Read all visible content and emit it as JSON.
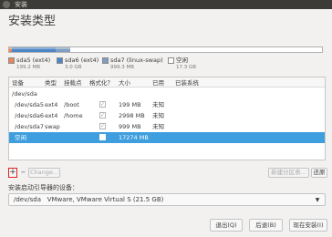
{
  "window": {
    "title": "安装"
  },
  "page": {
    "heading": "安装类型"
  },
  "partition_bar": {
    "segments": [
      {
        "name": "sda5 (ext4)",
        "color": "#e5875a",
        "fraction": 0.0093
      },
      {
        "name": "sda6 (ext4)",
        "color": "#4c86c6",
        "fraction": 0.1392
      },
      {
        "name": "sda7 (linux-swap)",
        "color": "#7f9dc1",
        "fraction": 0.0464
      },
      {
        "name": "空闲",
        "color": "#ffffff",
        "fraction": 0.8051
      }
    ]
  },
  "legend": [
    {
      "name": "sda5 (ext4)",
      "size": "199.2 MB",
      "color": "#e5875a"
    },
    {
      "name": "sda6 (ext4)",
      "size": "3.0 GB",
      "color": "#4c86c6"
    },
    {
      "name": "sda7 (linux-swap)",
      "size": "999.3 MB",
      "color": "#7f9dc1"
    },
    {
      "name": "空闲",
      "size": "17.3 GB",
      "color": "#ffffff"
    }
  ],
  "table": {
    "headers": [
      "设备",
      "类型",
      "挂载点",
      "格式化？",
      "大小",
      "已用",
      "已装系统"
    ],
    "rows": [
      {
        "device": "/dev/sda",
        "type": "",
        "mount": "",
        "format": "",
        "size": "",
        "used": "",
        "system": ""
      },
      {
        "device": "/dev/sda5",
        "type": "ext4",
        "mount": "/boot",
        "format": "✓",
        "size": "199 MB",
        "used": "未知",
        "system": ""
      },
      {
        "device": "/dev/sda6",
        "type": "ext4",
        "mount": "/home",
        "format": "✓",
        "size": "2998 MB",
        "used": "未知",
        "system": ""
      },
      {
        "device": "/dev/sda7",
        "type": "swap",
        "mount": "",
        "format": "✓",
        "size": "999 MB",
        "used": "未知",
        "system": ""
      },
      {
        "device": "空闲",
        "type": "",
        "mount": "",
        "format": "",
        "size": "17274 MB",
        "used": "",
        "system": ""
      }
    ],
    "selected_row": 4
  },
  "toolbar": {
    "add": "+",
    "remove": "−",
    "change": "Change...",
    "new_table": "新建分区表...",
    "revert": "还原"
  },
  "boot_loader": {
    "label": "安装启动引导器的设备：",
    "device": "/dev/sda",
    "description": "VMware, VMware Virtual S (21.5 GB)"
  },
  "actions": {
    "quit": "退出(Q)",
    "back": "后退(B)",
    "install": "现在安装(I)"
  }
}
